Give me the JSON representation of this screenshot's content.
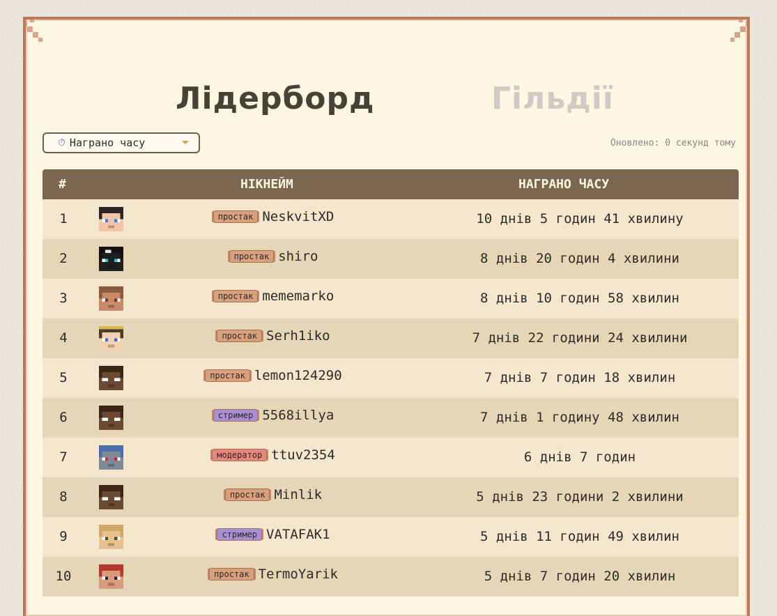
{
  "tabs": {
    "leaderboard": "Лідерборд",
    "guilds": "Гільдії"
  },
  "filter": {
    "selected": "Награно часу",
    "icon": "stopwatch-icon"
  },
  "updated_text": "Оновлено: 0 секунд тому",
  "table": {
    "headers": {
      "rank": "#",
      "nickname": "НІКНЕЙМ",
      "time": "НАГРАНО ЧАСУ"
    },
    "rows": [
      {
        "rank": "1",
        "badge": "простак",
        "badge_type": "plain",
        "name": "NeskvitXD",
        "time": "10 днів 5 годин 41 хвилину"
      },
      {
        "rank": "2",
        "badge": "простак",
        "badge_type": "plain",
        "name": "shiro",
        "time": "8 днів 20 годин 4 хвилини"
      },
      {
        "rank": "3",
        "badge": "простак",
        "badge_type": "plain",
        "name": "mememarko",
        "time": "8 днів 10 годин 58 хвилин"
      },
      {
        "rank": "4",
        "badge": "простак",
        "badge_type": "plain",
        "name": "Serh1iko",
        "time": "7 днів 22 години 24 хвилини"
      },
      {
        "rank": "5",
        "badge": "простак",
        "badge_type": "plain",
        "name": "lemon124290",
        "time": "7 днів 7 годин 18 хвилин"
      },
      {
        "rank": "6",
        "badge": "стример",
        "badge_type": "streamer",
        "name": "5568illya",
        "time": "7 днів 1 годину 48 хвилин"
      },
      {
        "rank": "7",
        "badge": "модератор",
        "badge_type": "moderator",
        "name": "ttuv2354",
        "time": "6 днів 7 годин"
      },
      {
        "rank": "8",
        "badge": "простак",
        "badge_type": "plain",
        "name": "Minlik",
        "time": "5 днів 23 години 2 хвилини"
      },
      {
        "rank": "9",
        "badge": "стример",
        "badge_type": "streamer",
        "name": "VATAFAK1",
        "time": "5 днів 11 годин 49 хвилин"
      },
      {
        "rank": "10",
        "badge": "простак",
        "badge_type": "plain",
        "name": "TermoYarik",
        "time": "5 днів 7 годин 20 хвилин"
      }
    ]
  },
  "colors": {
    "header_bg": "#7b664e",
    "row_odd": "#f5e7cd",
    "row_even": "#e4d6b7",
    "badge_plain": "#d9a07e",
    "badge_streamer": "#a88fd4",
    "badge_moderator": "#e7867a"
  }
}
